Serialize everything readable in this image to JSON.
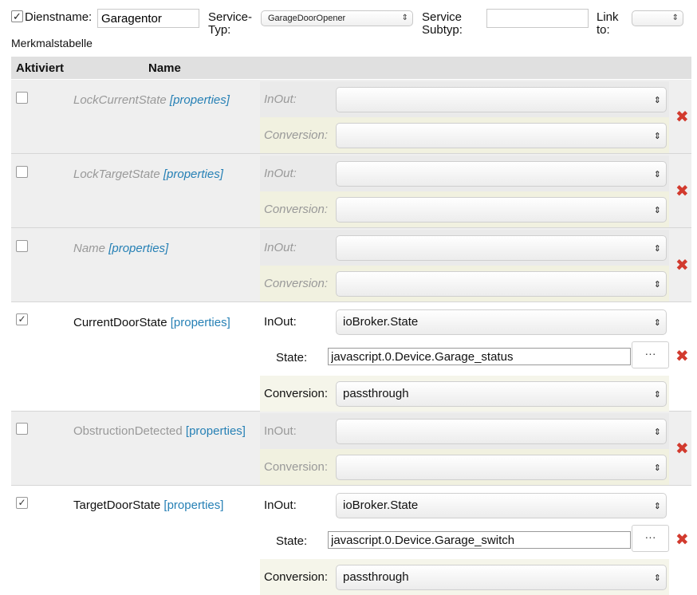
{
  "header": {
    "enabled_mark": "✓",
    "dienstname_label": "Dienstname:",
    "dienstname_value": "Garagentor",
    "service_typ_label_1": "Service-",
    "service_typ_label_2": "Typ:",
    "service_typ_value": "GarageDoorOpener",
    "service_subtyp_label_1": "Service",
    "service_subtyp_label_2": "Subtyp:",
    "service_subtyp_value": "",
    "link_label_1": "Link",
    "link_label_2": "to:",
    "link_value": ""
  },
  "merkmalstabelle_label": "Merkmalstabelle",
  "table": {
    "col_aktiviert": "Aktiviert",
    "col_name": "Name",
    "inout_label": "InOut:",
    "conversion_label": "Conversion:",
    "state_label": "State:",
    "properties_link": "[properties]",
    "dots_label": "···",
    "delete_glyph": "✖",
    "check_glyph": "✓",
    "rows": [
      {
        "name": "LockCurrentState",
        "checked": false,
        "inout": "",
        "conversion": ""
      },
      {
        "name": "LockTargetState",
        "checked": false,
        "inout": "",
        "conversion": ""
      },
      {
        "name": "Name",
        "checked": false,
        "inout": "",
        "conversion": ""
      },
      {
        "name": "CurrentDoorState",
        "checked": true,
        "inout": "ioBroker.State",
        "state": "javascript.0.Device.Garage_status",
        "conversion": "passthrough"
      },
      {
        "name": "ObstructionDetected",
        "checked": false,
        "inout": "",
        "conversion": ""
      },
      {
        "name": "TargetDoorState",
        "checked": true,
        "inout": "ioBroker.State",
        "state": "javascript.0.Device.Garage_switch",
        "conversion": "passthrough"
      }
    ]
  },
  "colors": {
    "accent_link": "#2680b5",
    "delete_red": "#d23a2e",
    "inactive_row_bg": "#efefef",
    "conversion_bg": "#f1f1e0"
  }
}
